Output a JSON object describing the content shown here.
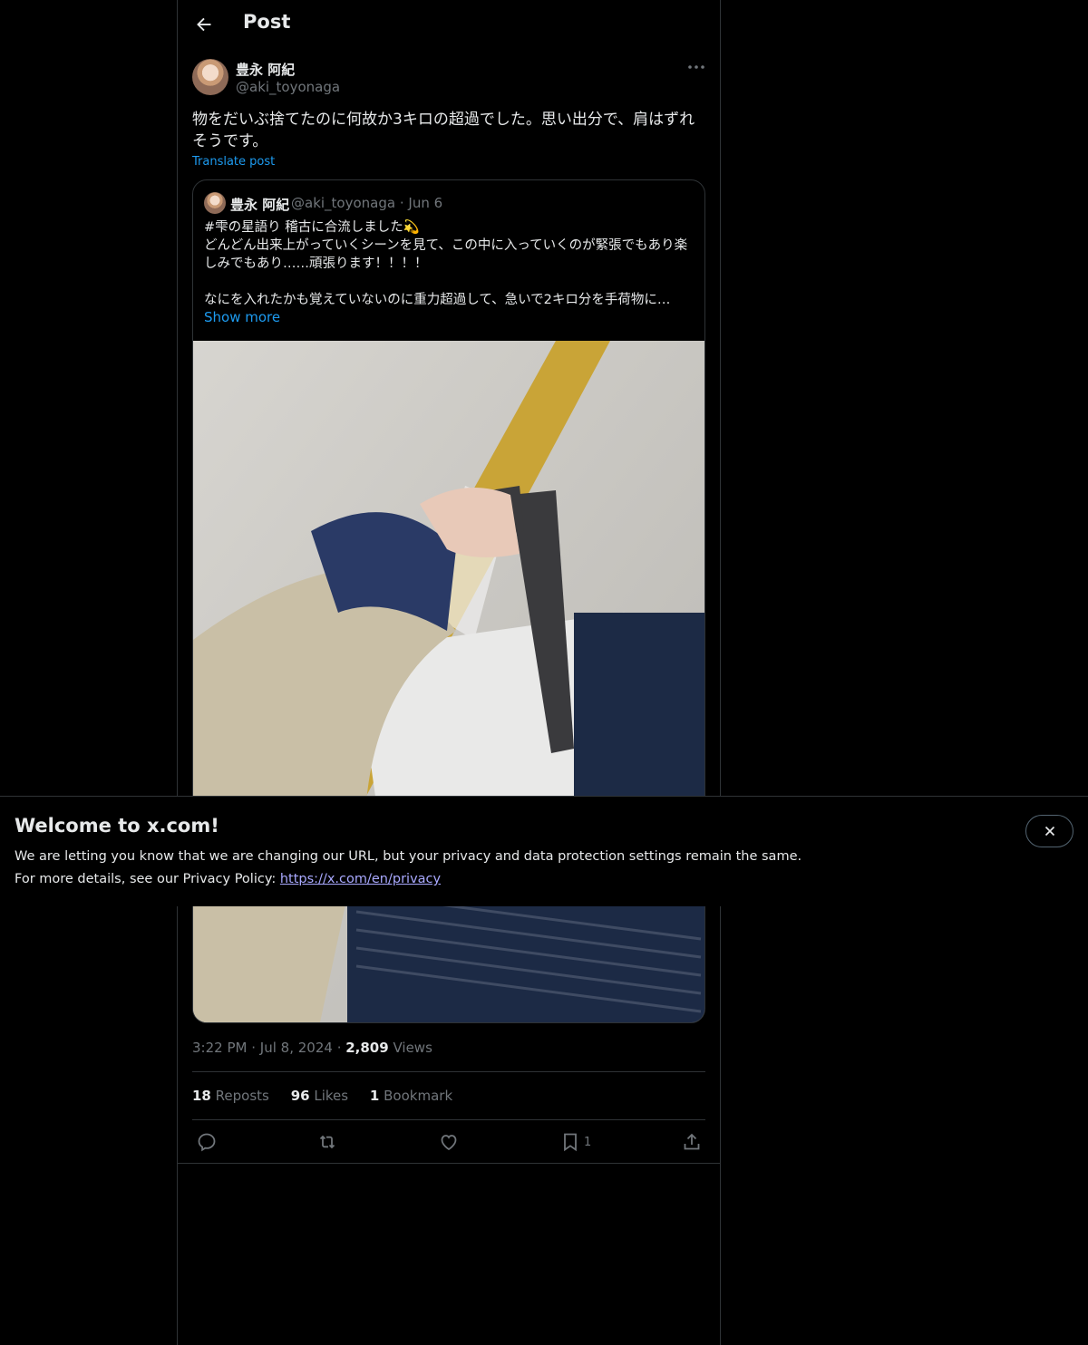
{
  "header": {
    "title": "Post"
  },
  "post": {
    "author_name": "豊永 阿紀",
    "author_handle": "@aki_toyonaga",
    "text": "物をだいぶ捨てたのに何故か3キロの超過でした。思い出分で、肩はずれそうです。",
    "translate_label": "Translate post",
    "time": "3:22 PM",
    "date": "Jul 8, 2024",
    "views_count": "2,809",
    "views_label": "Views",
    "reposts_count": "18",
    "reposts_label": "Reposts",
    "likes_count": "96",
    "likes_label": "Likes",
    "bookmarks_count": "1",
    "bookmarks_label": "Bookmark",
    "bookmark_action_count": "1"
  },
  "quote": {
    "author_name": "豊永 阿紀",
    "author_handle": "@aki_toyonaga",
    "date": "Jun 6",
    "line1": "#雫の星語り 稽古に合流しました💫",
    "line2": "どんどん出来上がっていくシーンを見て、この中に入っていくのが緊張でもあり楽しみでもあり……頑張ります！！！！",
    "line3": "なにを入れたかも覚えていないのに重力超過して、急いで2キロ分を手荷物に…",
    "show_more": "Show more"
  },
  "banner": {
    "title": "Welcome to x.com!",
    "line1": "We are letting you know that we are changing our URL, but your privacy and data protection settings remain the same.",
    "line2_prefix": "For more details, see our Privacy Policy: ",
    "link": "https://x.com/en/privacy"
  },
  "colors": {
    "accent": "#1d9bf0",
    "background": "#000000",
    "border": "#2f3336",
    "muted": "#71767b"
  },
  "icons": [
    "back-arrow-icon",
    "more-icon",
    "reply-icon",
    "repost-icon",
    "like-icon",
    "bookmark-icon",
    "share-icon",
    "close-icon"
  ]
}
